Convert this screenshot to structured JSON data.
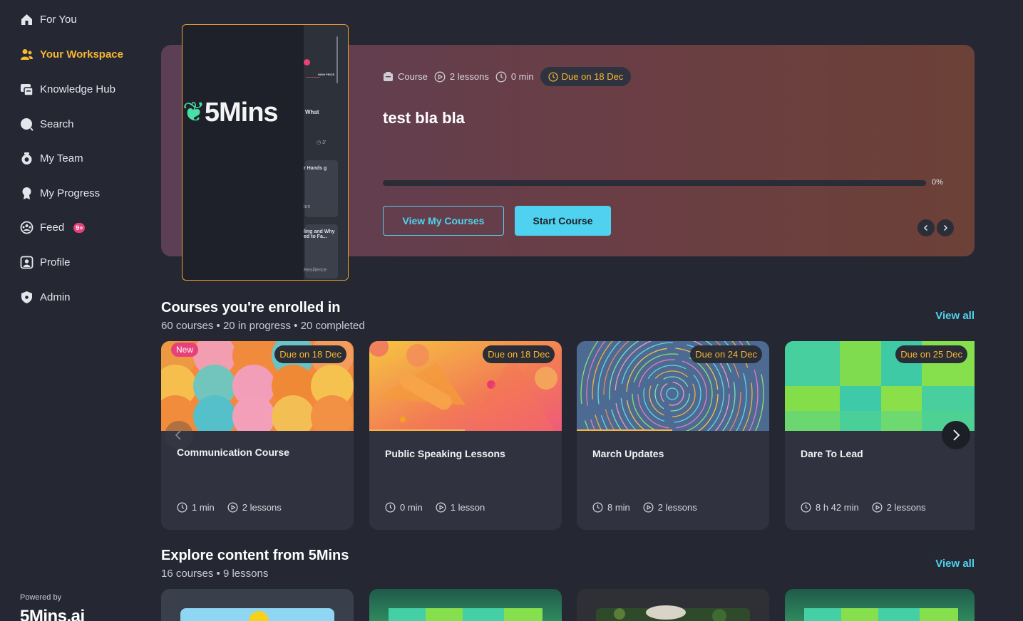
{
  "sidebar": {
    "items": [
      {
        "label": "For You",
        "icon": "home-icon"
      },
      {
        "label": "Your Workspace",
        "icon": "people-icon",
        "active": true
      },
      {
        "label": "Knowledge Hub",
        "icon": "hub-icon"
      },
      {
        "label": "Search",
        "icon": "search-icon"
      },
      {
        "label": "My Team",
        "icon": "team-icon"
      },
      {
        "label": "My Progress",
        "icon": "medal-icon"
      },
      {
        "label": "Feed",
        "icon": "feed-icon",
        "badge": "9+"
      },
      {
        "label": "Profile",
        "icon": "profile-icon"
      },
      {
        "label": "Admin",
        "icon": "shield-icon"
      }
    ],
    "powered_by": "Powered by",
    "brand": "5Mins.ai"
  },
  "hero": {
    "thumb_logo": "5Mins",
    "thumb_texts": [
      "What",
      "HIGH PRICE",
      "r Hands g",
      "ion",
      "ling and Why ed to Fa...",
      "Resilience"
    ],
    "type_label": "Course",
    "lessons": "2 lessons",
    "duration": "0 min",
    "due": "Due on 18 Dec",
    "title": "test bla bla",
    "progress_percent": 0,
    "progress_label": "0%",
    "view_courses_label": "View My Courses",
    "start_course_label": "Start Course"
  },
  "enrolled": {
    "title": "Courses you're enrolled in",
    "subtitle": "60 courses • 20 in progress • 20 completed",
    "view_all": "View all",
    "cards": [
      {
        "title": "Communication Course",
        "due": "Due on 18 Dec",
        "badge": "New",
        "duration": "1 min",
        "lessons": "2 lessons"
      },
      {
        "title": "Public Speaking Lessons",
        "due": "Due on 18 Dec",
        "duration": "0 min",
        "lessons": "1 lesson"
      },
      {
        "title": "March Updates",
        "due": "Due on 24 Dec",
        "duration": "8 min",
        "lessons": "2 lessons"
      },
      {
        "title": "Dare To Lead",
        "due": "Due on 25 Dec",
        "duration": "8 h 42 min",
        "lessons": "2 lessons"
      }
    ]
  },
  "explore": {
    "title": "Explore content from 5Mins",
    "subtitle": "16 courses • 9 lessons",
    "view_all": "View all"
  },
  "colors": {
    "background": "#252833",
    "accent": "#4fd2ef",
    "active": "#f7b733",
    "badge": "#e8417a"
  }
}
